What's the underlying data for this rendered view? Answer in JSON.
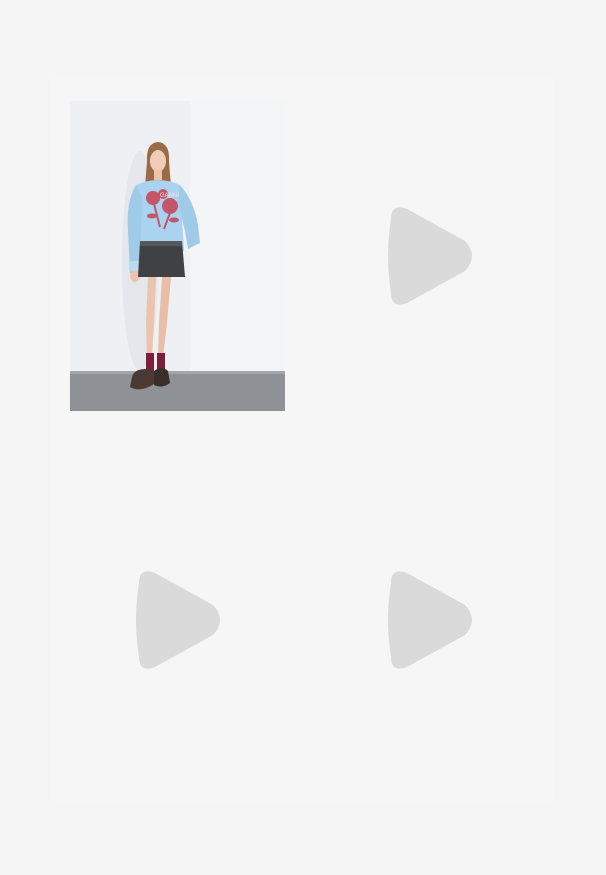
{
  "grid": {
    "items": [
      {
        "kind": "photo",
        "image": "model-wearing-light-blue-floral-sweatshirt-and-denim-skirt"
      },
      {
        "kind": "placeholder",
        "icon": "play-icon"
      },
      {
        "kind": "placeholder",
        "icon": "play-icon"
      },
      {
        "kind": "placeholder",
        "icon": "play-icon"
      }
    ]
  },
  "colors": {
    "page_background": "#f5f5f5",
    "placeholder_icon": "#dadada",
    "sweatshirt": "#a9d3ee",
    "print": "#c4566a",
    "skirt": "#3f4144",
    "socks": "#7a1f3d",
    "floor": "#8e9296"
  }
}
